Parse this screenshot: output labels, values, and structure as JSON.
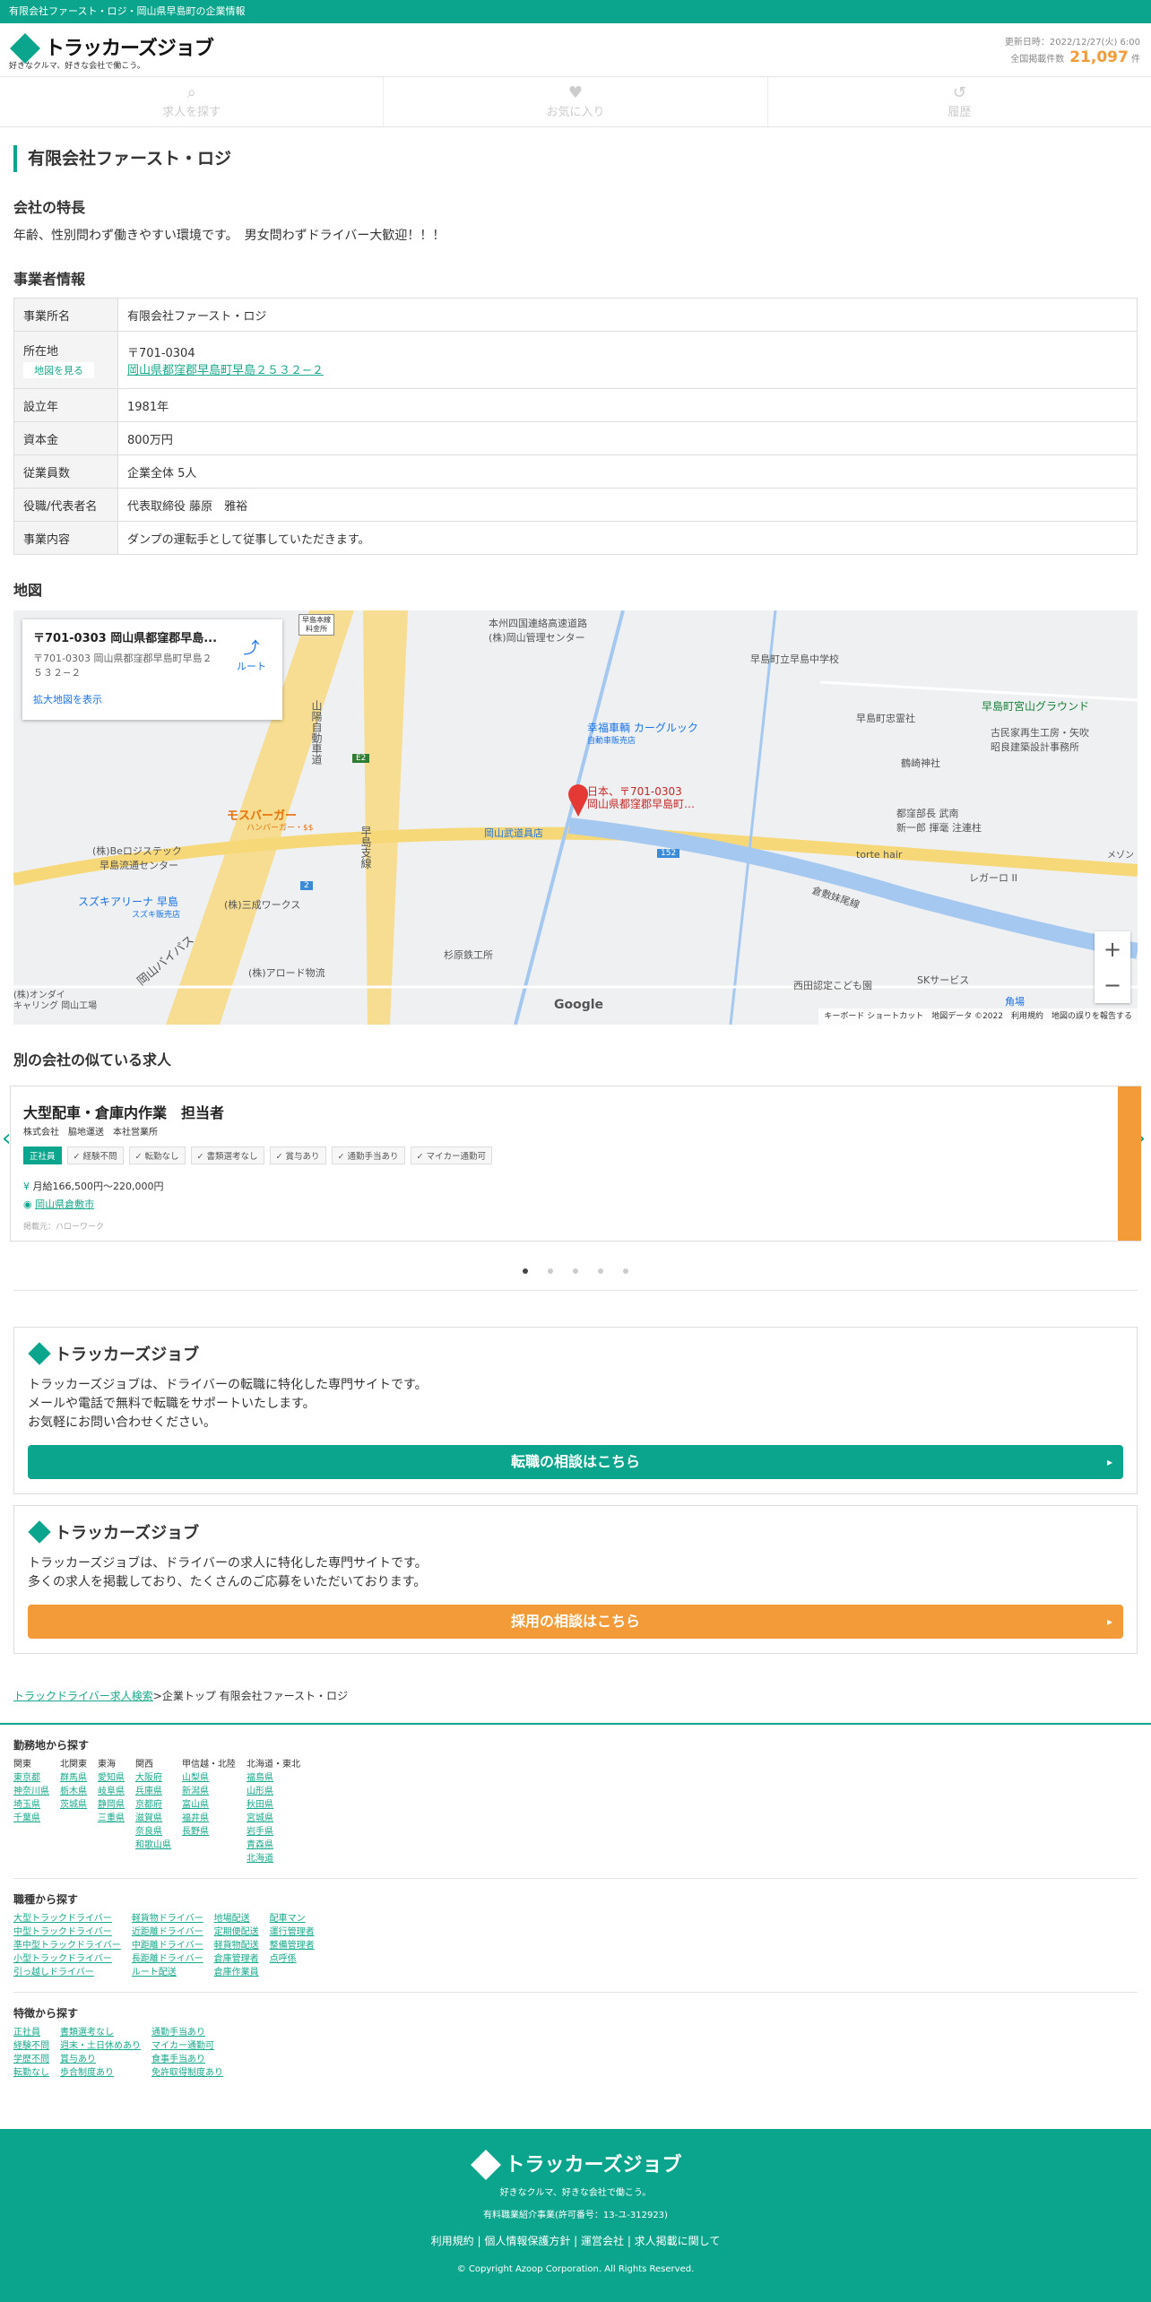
{
  "topbar": {
    "text": "有限会社ファースト・ロジ・岡山県早島町の企業情報"
  },
  "header": {
    "logo_text": "トラッカーズジョブ",
    "logo_sub": "好きなクルマ、好きな会社で働こう。",
    "update_label": "更新日時：2022/12/27(火) 6:00",
    "count_label": "全国掲載件数",
    "count_value": "21,097",
    "count_unit": "件"
  },
  "nav": [
    {
      "label": "求人を探す",
      "icon": "search-icon"
    },
    {
      "label": "お気に入り",
      "icon": "heart-icon"
    },
    {
      "label": "履歴",
      "icon": "history-icon"
    }
  ],
  "company": {
    "name": "有限会社ファースト・ロジ",
    "feature_heading": "会社の特長",
    "feature_text": "年齢、性別問わず働きやすい環境です。　男女問わずドライバー大歓迎！！！",
    "info_heading": "事業者情報",
    "rows": [
      {
        "k": "事業所名",
        "v": "有限会社ファースト・ロジ"
      },
      {
        "k": "所在地",
        "v": "〒701-0304",
        "link": "岡山県都窪郡早島町早島２５３２−２",
        "btn": "地図を見る"
      },
      {
        "k": "設立年",
        "v": "1981年"
      },
      {
        "k": "資本金",
        "v": "800万円"
      },
      {
        "k": "従業員数",
        "v": "企業全体 5人"
      },
      {
        "k": "役職/代表者名",
        "v": "代表取締役 藤原　雅裕"
      },
      {
        "k": "事業内容",
        "v": "ダンプの運転手として従事していただきます。"
      }
    ]
  },
  "map": {
    "heading": "地図",
    "card_title": "〒701-0303 岡山県都窪郡早島...",
    "card_sub": "〒701-0303 岡山県都窪郡早島町早島２５３２−２",
    "card_link": "拡大地図を表示",
    "route": "ルート",
    "pin_label1": "日本、〒701-0303",
    "pin_label2": "岡山県都窪郡早島町…",
    "labels": [
      "本州四国連絡高速道路",
      "(株)岡山管理センター",
      "早島町立早島中学校",
      "早島町宮山グラウンド",
      "幸福車輌 カーグルック",
      "自動車販売店",
      "早島町忠霊社",
      "鶴崎神社",
      "古民家再生工房・矢吹",
      "昭良建築設計事務所",
      "モスバーガー",
      "ハンバーガー・$$",
      "(株)Beロジステック",
      "早島流通センター",
      "岡山武道具店",
      "都窪部長 武南",
      "新一郎 揮毫 注連柱",
      "torte hair",
      "レガーロ II",
      "スズキアリーナ 早島",
      "スズキ販売店",
      "(株)三成ワークス",
      "倉敷妹尾線",
      "杉原鉄工所",
      "(株)アロード物流",
      "西田認定こども園",
      "SKサービス",
      "角場",
      "山陽自動車道",
      "早島支線",
      "岡山バイパス",
      "メゾン",
      "早島本線",
      "料金所",
      "(株)オンダイ",
      "キャリング 岡山工場",
      "152",
      "E2",
      "2"
    ],
    "footer": "キーボード ショートカット　地図データ ©2022　利用規約　地図の誤りを報告する",
    "google": "Google"
  },
  "similar": {
    "heading": "別の会社の似ている求人",
    "title": "大型配車・倉庫内作業　担当者",
    "company": "株式会社　脇地運送　本社営業所",
    "tags": [
      "正社員",
      "経験不問",
      "転勤なし",
      "書類選考なし",
      "賞与あり",
      "通勤手当あり",
      "マイカー通勤可"
    ],
    "salary": "月給166,500円〜220,000円",
    "location": "岡山県倉敷市",
    "source": "掲載元：ハローワーク"
  },
  "promo1": {
    "logo": "トラッカーズジョブ",
    "lines": [
      "トラッカーズジョブは、ドライバーの転職に特化した専門サイトです。",
      "メールや電話で無料で転職をサポートいたします。",
      "お気軽にお問い合わせください。"
    ],
    "cta": "転職の相談はこちら"
  },
  "promo2": {
    "logo": "トラッカーズジョブ",
    "lines": [
      "トラッカーズジョブは、ドライバーの求人に特化した専門サイトです。",
      "多くの求人を掲載しており、たくさんのご応募をいただいております。"
    ],
    "cta": "採用の相談はこちら"
  },
  "breadcrumb": {
    "link": "トラックドライバー求人検索",
    "rest": ">企業トップ 有限会社ファースト・ロジ"
  },
  "footer_area": {
    "heading": "勤務地から探す",
    "cols": [
      {
        "h": "関東",
        "items": [
          "東京都",
          "神奈川県",
          "埼玉県",
          "千葉県"
        ]
      },
      {
        "h": "北関東",
        "items": [
          "群馬県",
          "栃木県",
          "茨城県"
        ]
      },
      {
        "h": "東海",
        "items": [
          "愛知県",
          "岐阜県",
          "静岡県",
          "三重県"
        ]
      },
      {
        "h": "関西",
        "items": [
          "大阪府",
          "兵庫県",
          "京都府",
          "滋賀県",
          "奈良県",
          "和歌山県"
        ]
      },
      {
        "h": "甲信越・北陸",
        "items": [
          "山梨県",
          "新潟県",
          "富山県",
          "福井県",
          "長野県"
        ]
      },
      {
        "h": "北海道・東北",
        "items": [
          "福島県",
          "山形県",
          "秋田県",
          "宮城県",
          "岩手県",
          "青森県",
          "北海道"
        ]
      }
    ]
  },
  "footer_job": {
    "heading": "職種から探す",
    "cols": [
      {
        "items": [
          "大型トラックドライバー",
          "中型トラックドライバー",
          "準中型トラックドライバー",
          "小型トラックドライバー",
          "引っ越しドライバー"
        ]
      },
      {
        "items": [
          "軽貨物ドライバー",
          "近距離ドライバー",
          "中距離ドライバー",
          "長距離ドライバー",
          "ルート配送"
        ]
      },
      {
        "items": [
          "地場配送",
          "定期便配送",
          "軽貨物配送",
          "倉庫管理者",
          "倉庫作業員"
        ]
      },
      {
        "items": [
          "配車マン",
          "運行管理者",
          "整備管理者",
          "点呼係"
        ]
      }
    ]
  },
  "footer_feature": {
    "heading": "特徴から探す",
    "cols": [
      {
        "items": [
          "正社員",
          "経験不問",
          "学歴不問",
          "転勤なし"
        ]
      },
      {
        "items": [
          "書類選考なし",
          "週末・土日休めあり",
          "賞与あり",
          "歩合制度あり"
        ]
      },
      {
        "items": [
          "通勤手当あり",
          "マイカー通勤可",
          "食事手当あり",
          "免許取得制度あり"
        ]
      }
    ]
  },
  "bottom": {
    "logo": "トラッカーズジョブ",
    "sub": "好きなクルマ、好きな会社で働こう。",
    "reg": "有料職業紹介事業(許可番号：13-ユ-312923)",
    "links": "利用規約 | 個人情報保護方針 | 運営会社 | 求人掲載に関して",
    "copy": "© Copyright Azoop Corporation. All Rights Reserved."
  },
  "colors": {
    "accent": "#0aa58c",
    "orange": "#f29b38"
  }
}
